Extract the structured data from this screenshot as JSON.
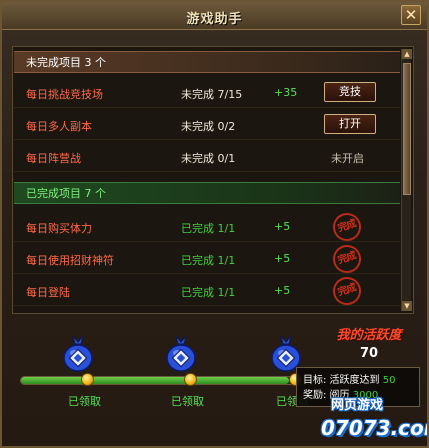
{
  "window": {
    "title": "游戏助手",
    "close_glyph": "✕"
  },
  "incomplete_section": {
    "label": "未完成项目 3 个",
    "rows": [
      {
        "name": "每日挑战竞技场",
        "status": "未完成 7/15",
        "points": "+35",
        "action": "竞技"
      },
      {
        "name": "每日多人副本",
        "status": "未完成 0/2",
        "points": "",
        "action": "打开"
      },
      {
        "name": "每日阵营战",
        "status": "未完成 0/1",
        "points": "",
        "note": "未开启"
      }
    ]
  },
  "complete_section": {
    "label": "已完成项目 7 个",
    "rows": [
      {
        "name": "每日购买体力",
        "status": "已完成 1/1",
        "points": "+5",
        "stamp": "完成"
      },
      {
        "name": "每日使用招财神符",
        "status": "已完成 1/1",
        "points": "+5",
        "stamp": "完成"
      },
      {
        "name": "每日登陆",
        "status": "已完成 1/1",
        "points": "+5",
        "stamp": "完成"
      }
    ]
  },
  "activity": {
    "title": "我的活跃度",
    "value": "70",
    "progress_fraction": 0.9,
    "rewards": [
      {
        "label": "已领取",
        "icon": "reward-bag-icon"
      },
      {
        "label": "已领取",
        "icon": "reward-bag-icon"
      },
      {
        "label": "已领取",
        "icon": "reward-bag-icon"
      }
    ]
  },
  "tooltip": {
    "target_label": "目标: 活跃度达到",
    "target_value": "50",
    "reward_label": "奖励: 阅历",
    "reward_value": "3000"
  },
  "watermark": {
    "text": "网页游戏",
    "number": "07073.com"
  },
  "colors": {
    "incomplete_name": "#ff6a4a",
    "complete_status": "#40d040",
    "points": "#58e058",
    "activity_title": "#ff4a2a",
    "header_complete": "#7ef07e"
  }
}
